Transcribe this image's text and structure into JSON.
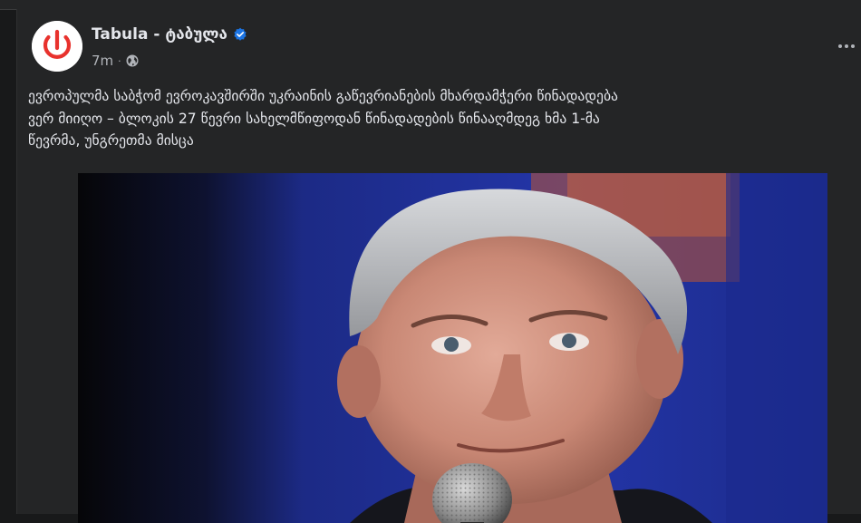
{
  "post": {
    "page_name": "Tabula - ტაბულა",
    "verified_icon": "verified-badge-icon",
    "timestamp": "7m",
    "separator": "·",
    "audience_icon": "globe-icon",
    "more_icon": "more-options-icon",
    "text_lines": [
      "ევროპულმა საბჭომ ევროკავშირში უკრაინის გაწევრიანების მხარდამჭერი წინადადება",
      "ვერ მიიღო – ბლოკის 27 წევრი სახელმწიფოდან წინადადების წინააღმდეგ ხმა 1-მა",
      "წევრმა, უნგრეთმა მისცა"
    ],
    "image_icon": "photo-of-speaker-at-microphone"
  },
  "colors": {
    "card_bg": "#242526",
    "text_primary": "#e4e6eb",
    "text_secondary": "#b0b3b8",
    "verified": "#1b74e4",
    "logo_red": "#e8322d",
    "image_backdrop": "#1e2c8a"
  }
}
